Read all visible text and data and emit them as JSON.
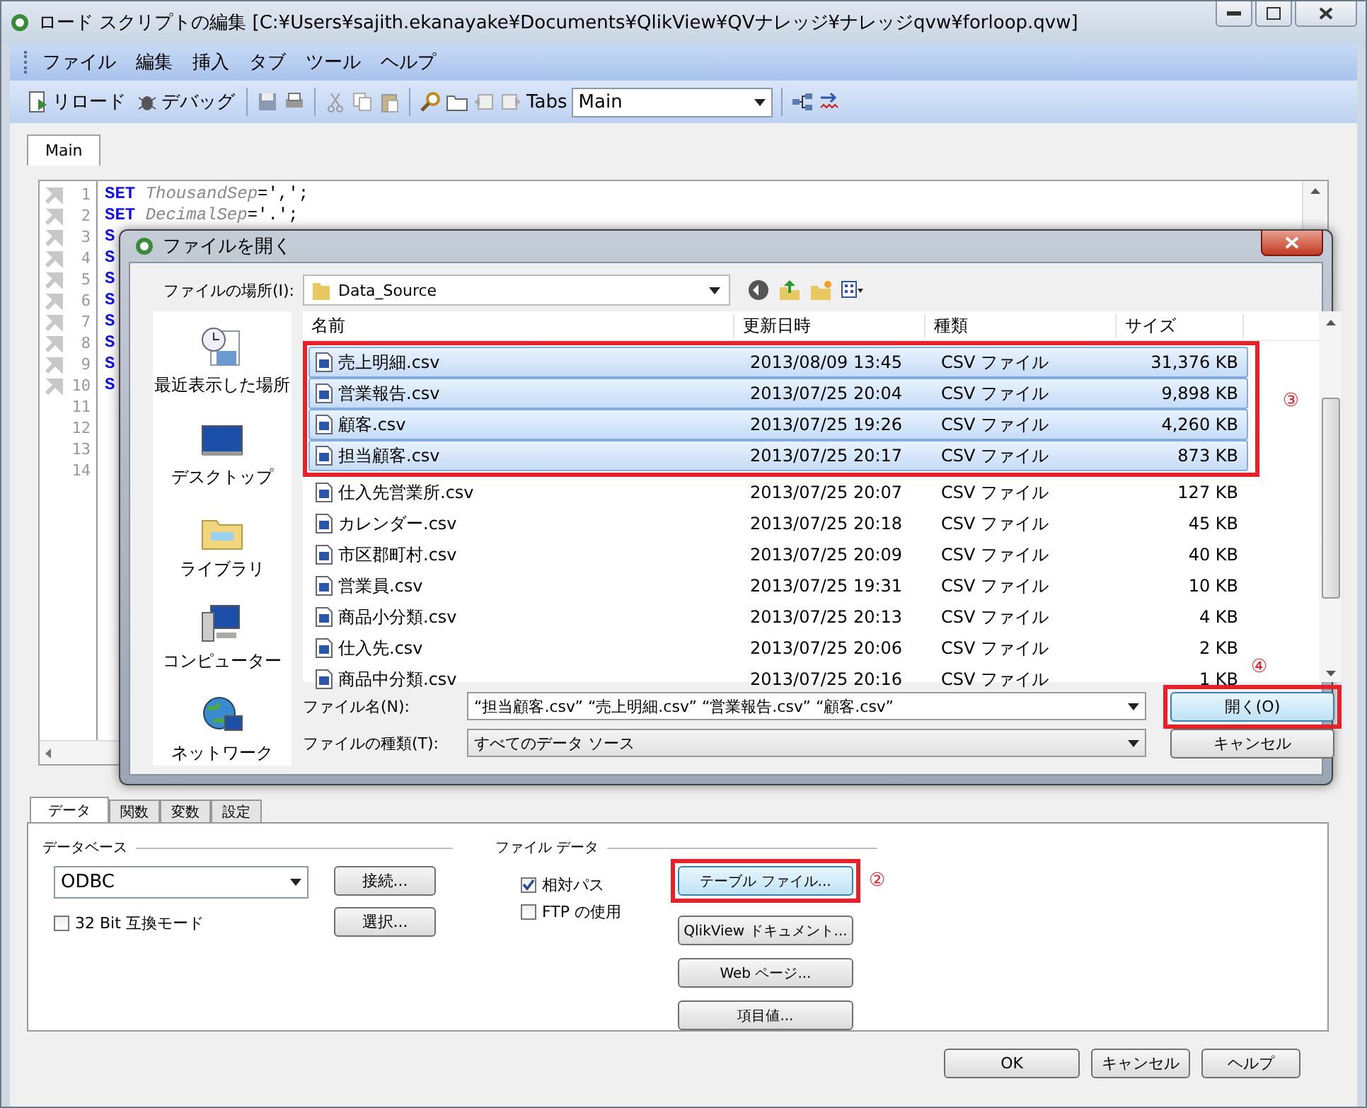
{
  "window": {
    "title": "ロード スクリプトの編集 [C:¥Users¥sajith.ekanayake¥Documents¥QlikView¥QVナレッジ¥ナレッジqvw¥forloop.qvw]"
  },
  "menu": [
    "ファイル",
    "編集",
    "挿入",
    "タブ",
    "ツール",
    "ヘルプ"
  ],
  "toolbar": {
    "reload": "リロード",
    "debug": "デバッグ",
    "tabs_label": "Tabs",
    "tabs_value": "Main"
  },
  "script_tabs": [
    {
      "label": "Main",
      "selected": true
    }
  ],
  "script_lines": [
    {
      "number": "1",
      "marker": true,
      "keyword": "SET",
      "name": "ThousandSep",
      "value": "=',';"
    },
    {
      "number": "2",
      "marker": true,
      "keyword": "SET",
      "name": "DecimalSep",
      "value": "='.';"
    },
    {
      "number": "3",
      "marker": true,
      "keyword": "S"
    },
    {
      "number": "4",
      "marker": true,
      "keyword": "S"
    },
    {
      "number": "5",
      "marker": true,
      "keyword": "S"
    },
    {
      "number": "6",
      "marker": true,
      "keyword": "S"
    },
    {
      "number": "7",
      "marker": true,
      "keyword": "S"
    },
    {
      "number": "8",
      "marker": true,
      "keyword": "S"
    },
    {
      "number": "9",
      "marker": true,
      "keyword": "S"
    },
    {
      "number": "10",
      "marker": true,
      "keyword": "S"
    },
    {
      "number": "11",
      "marker": false
    },
    {
      "number": "12",
      "marker": false
    },
    {
      "number": "13",
      "marker": false
    },
    {
      "number": "14",
      "marker": false
    }
  ],
  "bottom_tabs": [
    {
      "label": "データ",
      "selected": true
    },
    {
      "label": "関数",
      "selected": false
    },
    {
      "label": "変数",
      "selected": false
    },
    {
      "label": "設定",
      "selected": false
    }
  ],
  "database": {
    "legend": "データベース",
    "value": "ODBC",
    "compat": {
      "label": "32 Bit 互換モード",
      "checked": false
    },
    "buttons": [
      "接続...",
      "選択..."
    ]
  },
  "file_data": {
    "legend": "ファイル データ",
    "options": [
      {
        "label": "相対パス",
        "checked": true
      },
      {
        "label": "FTP の使用",
        "checked": false
      }
    ],
    "buttons": [
      {
        "label": "テーブル ファイル...",
        "highlighted": true,
        "annotation": "②"
      },
      {
        "label": "QlikView ドキュメント...",
        "highlighted": false
      },
      {
        "label": "Web ページ...",
        "highlighted": false
      },
      {
        "label": "項目値...",
        "highlighted": false
      }
    ]
  },
  "footer_buttons": [
    "OK",
    "キャンセル",
    "ヘルプ"
  ],
  "dialog": {
    "title": "ファイルを開く",
    "location_label": "ファイルの場所(I):",
    "location": "Data_Source",
    "places": [
      "最近表示した場所",
      "デスクトップ",
      "ライブラリ",
      "コンピューター",
      "ネットワーク"
    ],
    "columns": [
      "名前",
      "更新日時",
      "種類",
      "サイズ"
    ],
    "files": [
      {
        "name": "売上明細.csv",
        "date": "2013/08/09 13:45",
        "type": "CSV ファイル",
        "size": "31,376 KB",
        "selected": true
      },
      {
        "name": "営業報告.csv",
        "date": "2013/07/25 20:04",
        "type": "CSV ファイル",
        "size": "9,898 KB",
        "selected": true
      },
      {
        "name": "顧客.csv",
        "date": "2013/07/25 19:26",
        "type": "CSV ファイル",
        "size": "4,260 KB",
        "selected": true
      },
      {
        "name": "担当顧客.csv",
        "date": "2013/07/25 20:17",
        "type": "CSV ファイル",
        "size": "873 KB",
        "selected": true
      },
      {
        "name": "仕入先営業所.csv",
        "date": "2013/07/25 20:07",
        "type": "CSV ファイル",
        "size": "127 KB",
        "selected": false
      },
      {
        "name": "カレンダー.csv",
        "date": "2013/07/25 20:18",
        "type": "CSV ファイル",
        "size": "45 KB",
        "selected": false
      },
      {
        "name": "市区郡町村.csv",
        "date": "2013/07/25 20:09",
        "type": "CSV ファイル",
        "size": "40 KB",
        "selected": false
      },
      {
        "name": "営業員.csv",
        "date": "2013/07/25 19:31",
        "type": "CSV ファイル",
        "size": "10 KB",
        "selected": false
      },
      {
        "name": "商品小分類.csv",
        "date": "2013/07/25 20:13",
        "type": "CSV ファイル",
        "size": "4 KB",
        "selected": false
      },
      {
        "name": "仕入先.csv",
        "date": "2013/07/25 20:06",
        "type": "CSV ファイル",
        "size": "2 KB",
        "selected": false
      },
      {
        "name": "商品中分類.csv",
        "date": "2013/07/25 20:16",
        "type": "CSV ファイル",
        "size": "1 KB",
        "selected": false
      }
    ],
    "selection_annotation": "③",
    "filename_label": "ファイル名(N):",
    "filename": "“担当顧客.csv” “売上明細.csv” “営業報告.csv” “顧客.csv”",
    "filetype_label": "ファイルの種類(T):",
    "filetype": "すべてのデータ ソース",
    "open_button": "開く(O)",
    "open_annotation": "④",
    "cancel_button": "キャンセル"
  }
}
